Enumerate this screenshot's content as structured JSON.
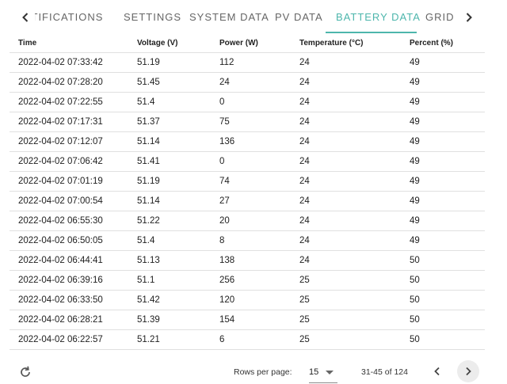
{
  "tabs": {
    "items": [
      {
        "label": "NOTIFICATIONS",
        "active": false
      },
      {
        "label": "SETTINGS",
        "active": false
      },
      {
        "label": "SYSTEM DATA",
        "active": false
      },
      {
        "label": "PV DATA",
        "active": false
      },
      {
        "label": "BATTERY DATA",
        "active": true
      },
      {
        "label": "GRID",
        "active": false
      }
    ],
    "scroll_left_icon": "chevron-left-icon",
    "scroll_right_icon": "chevron-right-icon",
    "active_color": "#4db6ac"
  },
  "table": {
    "columns": [
      "Time",
      "Voltage (V)",
      "Power (W)",
      "Temperature (°C)",
      "Percent (%)"
    ],
    "rows": [
      [
        "2022-04-02 07:33:42",
        "51.19",
        "112",
        "24",
        "49"
      ],
      [
        "2022-04-02 07:28:20",
        "51.45",
        "24",
        "24",
        "49"
      ],
      [
        "2022-04-02 07:22:55",
        "51.4",
        "0",
        "24",
        "49"
      ],
      [
        "2022-04-02 07:17:31",
        "51.37",
        "75",
        "24",
        "49"
      ],
      [
        "2022-04-02 07:12:07",
        "51.14",
        "136",
        "24",
        "49"
      ],
      [
        "2022-04-02 07:06:42",
        "51.41",
        "0",
        "24",
        "49"
      ],
      [
        "2022-04-02 07:01:19",
        "51.19",
        "74",
        "24",
        "49"
      ],
      [
        "2022-04-02 07:00:54",
        "51.14",
        "27",
        "24",
        "49"
      ],
      [
        "2022-04-02 06:55:30",
        "51.22",
        "20",
        "24",
        "49"
      ],
      [
        "2022-04-02 06:50:05",
        "51.4",
        "8",
        "24",
        "49"
      ],
      [
        "2022-04-02 06:44:41",
        "51.13",
        "138",
        "24",
        "50"
      ],
      [
        "2022-04-02 06:39:16",
        "51.1",
        "256",
        "25",
        "50"
      ],
      [
        "2022-04-02 06:33:50",
        "51.42",
        "120",
        "25",
        "50"
      ],
      [
        "2022-04-02 06:28:21",
        "51.39",
        "154",
        "25",
        "50"
      ],
      [
        "2022-04-02 06:22:57",
        "51.21",
        "6",
        "25",
        "50"
      ]
    ]
  },
  "footer": {
    "refresh_icon": "refresh-icon",
    "rows_per_page_label": "Rows per page:",
    "rows_per_page_value": "15",
    "range_text": "31-45 of 124",
    "prev_icon": "chevron-left-icon",
    "next_icon": "chevron-right-icon"
  }
}
